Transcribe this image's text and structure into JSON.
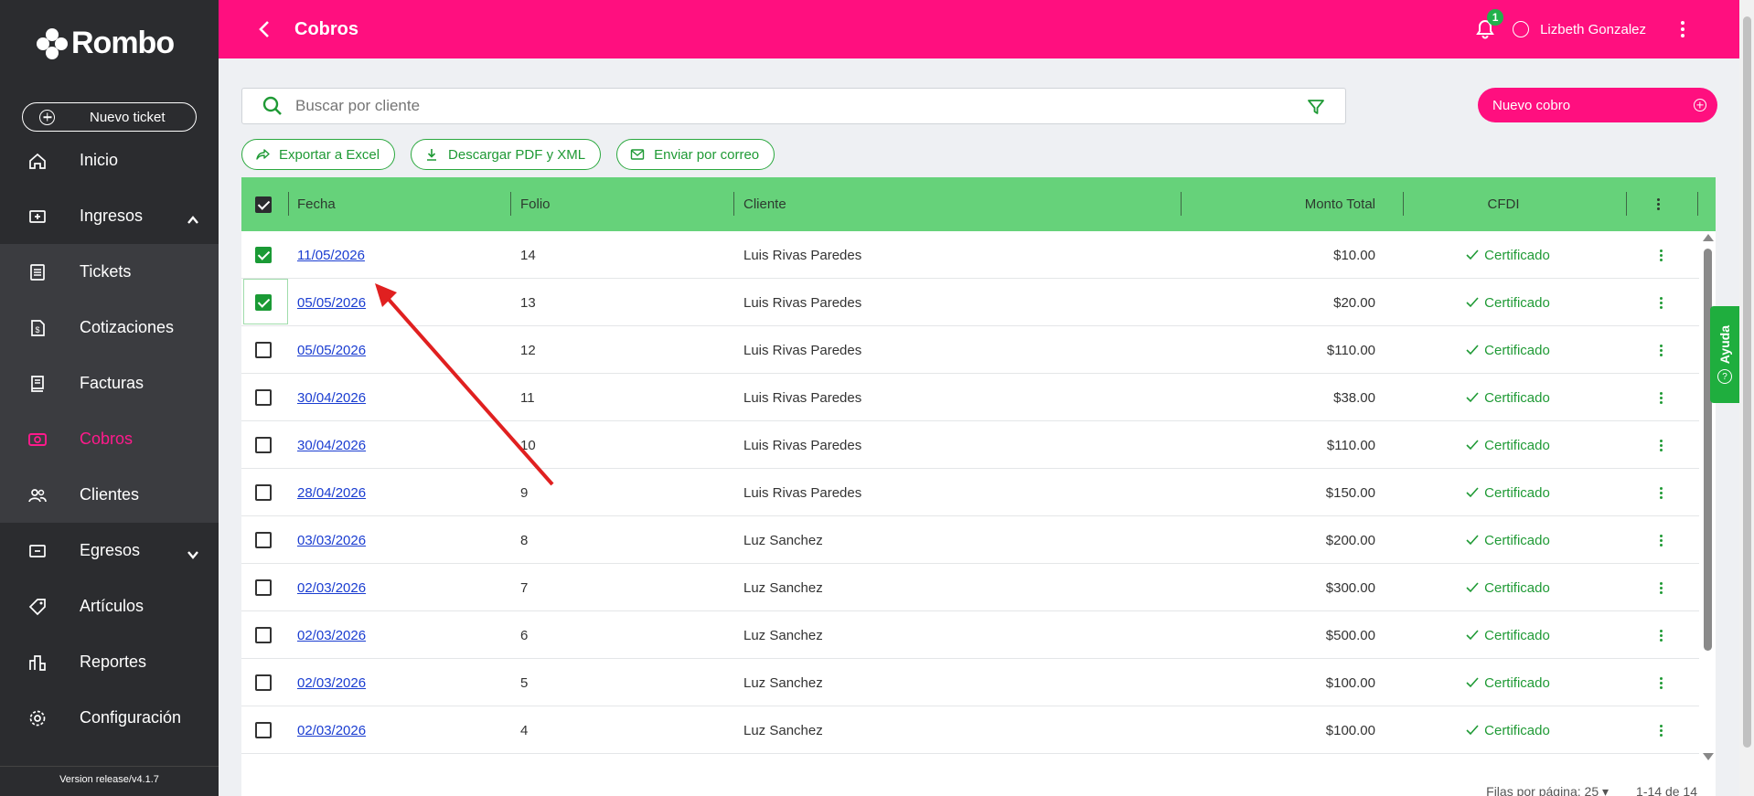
{
  "app": {
    "brand": "Rombo",
    "version": "Version release/v4.1.7"
  },
  "sidebar": {
    "new_ticket": "Nuevo ticket",
    "items": [
      {
        "label": "Inicio",
        "icon": "home-icon"
      },
      {
        "label": "Ingresos",
        "icon": "income-icon",
        "expanded": true
      },
      {
        "label": "Tickets",
        "icon": "ticket-icon"
      },
      {
        "label": "Cotizaciones",
        "icon": "quote-icon"
      },
      {
        "label": "Facturas",
        "icon": "invoice-icon"
      },
      {
        "label": "Cobros",
        "icon": "payment-icon",
        "active": true
      },
      {
        "label": "Clientes",
        "icon": "clients-icon"
      },
      {
        "label": "Egresos",
        "icon": "expense-icon",
        "expanded": false
      },
      {
        "label": "Artículos",
        "icon": "tag-icon"
      },
      {
        "label": "Reportes",
        "icon": "reports-icon"
      },
      {
        "label": "Configuración",
        "icon": "gear-icon"
      }
    ]
  },
  "header": {
    "title": "Cobros",
    "notifications": "1",
    "user": "Lizbeth Gonzalez"
  },
  "search": {
    "placeholder": "Buscar por cliente"
  },
  "new_cobro": "Nuevo cobro",
  "actions": {
    "export_excel": "Exportar a Excel",
    "download_pdf": "Descargar PDF y XML",
    "send_email": "Enviar por correo"
  },
  "table": {
    "columns": {
      "fecha": "Fecha",
      "folio": "Folio",
      "cliente": "Cliente",
      "monto": "Monto Total",
      "cfdi": "CFDI"
    },
    "rows": [
      {
        "fecha": "11/05/2026",
        "folio": "14",
        "cliente": "Luis Rivas Paredes",
        "monto": "$10.00",
        "cfdi": "Certificado",
        "checked": true
      },
      {
        "fecha": "05/05/2026",
        "folio": "13",
        "cliente": "Luis Rivas Paredes",
        "monto": "$20.00",
        "cfdi": "Certificado",
        "checked": true
      },
      {
        "fecha": "05/05/2026",
        "folio": "12",
        "cliente": "Luis Rivas Paredes",
        "monto": "$110.00",
        "cfdi": "Certificado",
        "checked": false
      },
      {
        "fecha": "30/04/2026",
        "folio": "11",
        "cliente": "Luis Rivas Paredes",
        "monto": "$38.00",
        "cfdi": "Certificado",
        "checked": false
      },
      {
        "fecha": "30/04/2026",
        "folio": "10",
        "cliente": "Luis Rivas Paredes",
        "monto": "$110.00",
        "cfdi": "Certificado",
        "checked": false
      },
      {
        "fecha": "28/04/2026",
        "folio": "9",
        "cliente": "Luis Rivas Paredes",
        "monto": "$150.00",
        "cfdi": "Certificado",
        "checked": false
      },
      {
        "fecha": "03/03/2026",
        "folio": "8",
        "cliente": "Luz Sanchez",
        "monto": "$200.00",
        "cfdi": "Certificado",
        "checked": false
      },
      {
        "fecha": "02/03/2026",
        "folio": "7",
        "cliente": "Luz Sanchez",
        "monto": "$300.00",
        "cfdi": "Certificado",
        "checked": false
      },
      {
        "fecha": "02/03/2026",
        "folio": "6",
        "cliente": "Luz Sanchez",
        "monto": "$500.00",
        "cfdi": "Certificado",
        "checked": false
      },
      {
        "fecha": "02/03/2026",
        "folio": "5",
        "cliente": "Luz Sanchez",
        "monto": "$100.00",
        "cfdi": "Certificado",
        "checked": false
      },
      {
        "fecha": "02/03/2026",
        "folio": "4",
        "cliente": "Luz Sanchez",
        "monto": "$100.00",
        "cfdi": "Certificado",
        "checked": false
      }
    ]
  },
  "pager": {
    "rows_label": "Filas por página:",
    "rows_value": "25",
    "range": "1-14 de 14"
  },
  "help": {
    "label": "Ayuda"
  },
  "colors": {
    "brand_pink": "#ff0f7f",
    "header_green": "#66d27a",
    "accent_green": "#1f9a35",
    "sidebar": "#2b2c2f"
  }
}
